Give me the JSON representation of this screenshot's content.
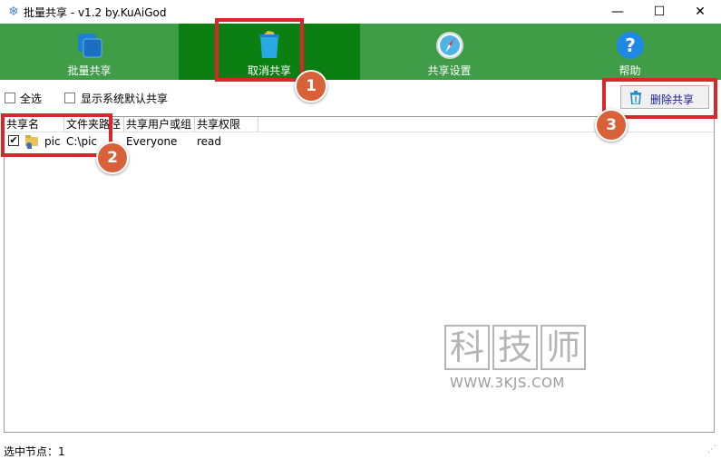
{
  "window": {
    "title": "批量共享 - v1.2 by.KuAiGod",
    "app_icon": "snowflake-icon",
    "controls": {
      "minimize": "—",
      "maximize": "☐",
      "close": "✕"
    }
  },
  "ribbon": {
    "color": "#3f9d48",
    "active_color": "#0b7f12",
    "tabs": [
      {
        "label": "批量共享",
        "icon": "share-stack-icon"
      },
      {
        "label": "取消共享",
        "icon": "trash-icon"
      },
      {
        "label": "共享设置",
        "icon": "compass-icon"
      },
      {
        "label": "帮助",
        "icon": "help-icon"
      }
    ]
  },
  "options": {
    "select_all": "全选",
    "show_system": "显示系统默认共享",
    "delete_button": "删除共享"
  },
  "table": {
    "columns": [
      "共享名",
      "文件夹路径",
      "共享用户或组",
      "共享权限"
    ],
    "rows": [
      {
        "checked": true,
        "name": "pic",
        "path": "C:\\pic",
        "user": "Everyone",
        "permission": "read"
      }
    ]
  },
  "annotations": {
    "marker_1": "1",
    "marker_2": "2",
    "marker_3": "3",
    "color": "#d9262c"
  },
  "watermark": {
    "chars": [
      "科",
      "技",
      "师"
    ],
    "url": "WWW.3KJS.COM"
  },
  "status": {
    "selected_nodes": "选中节点：1"
  }
}
